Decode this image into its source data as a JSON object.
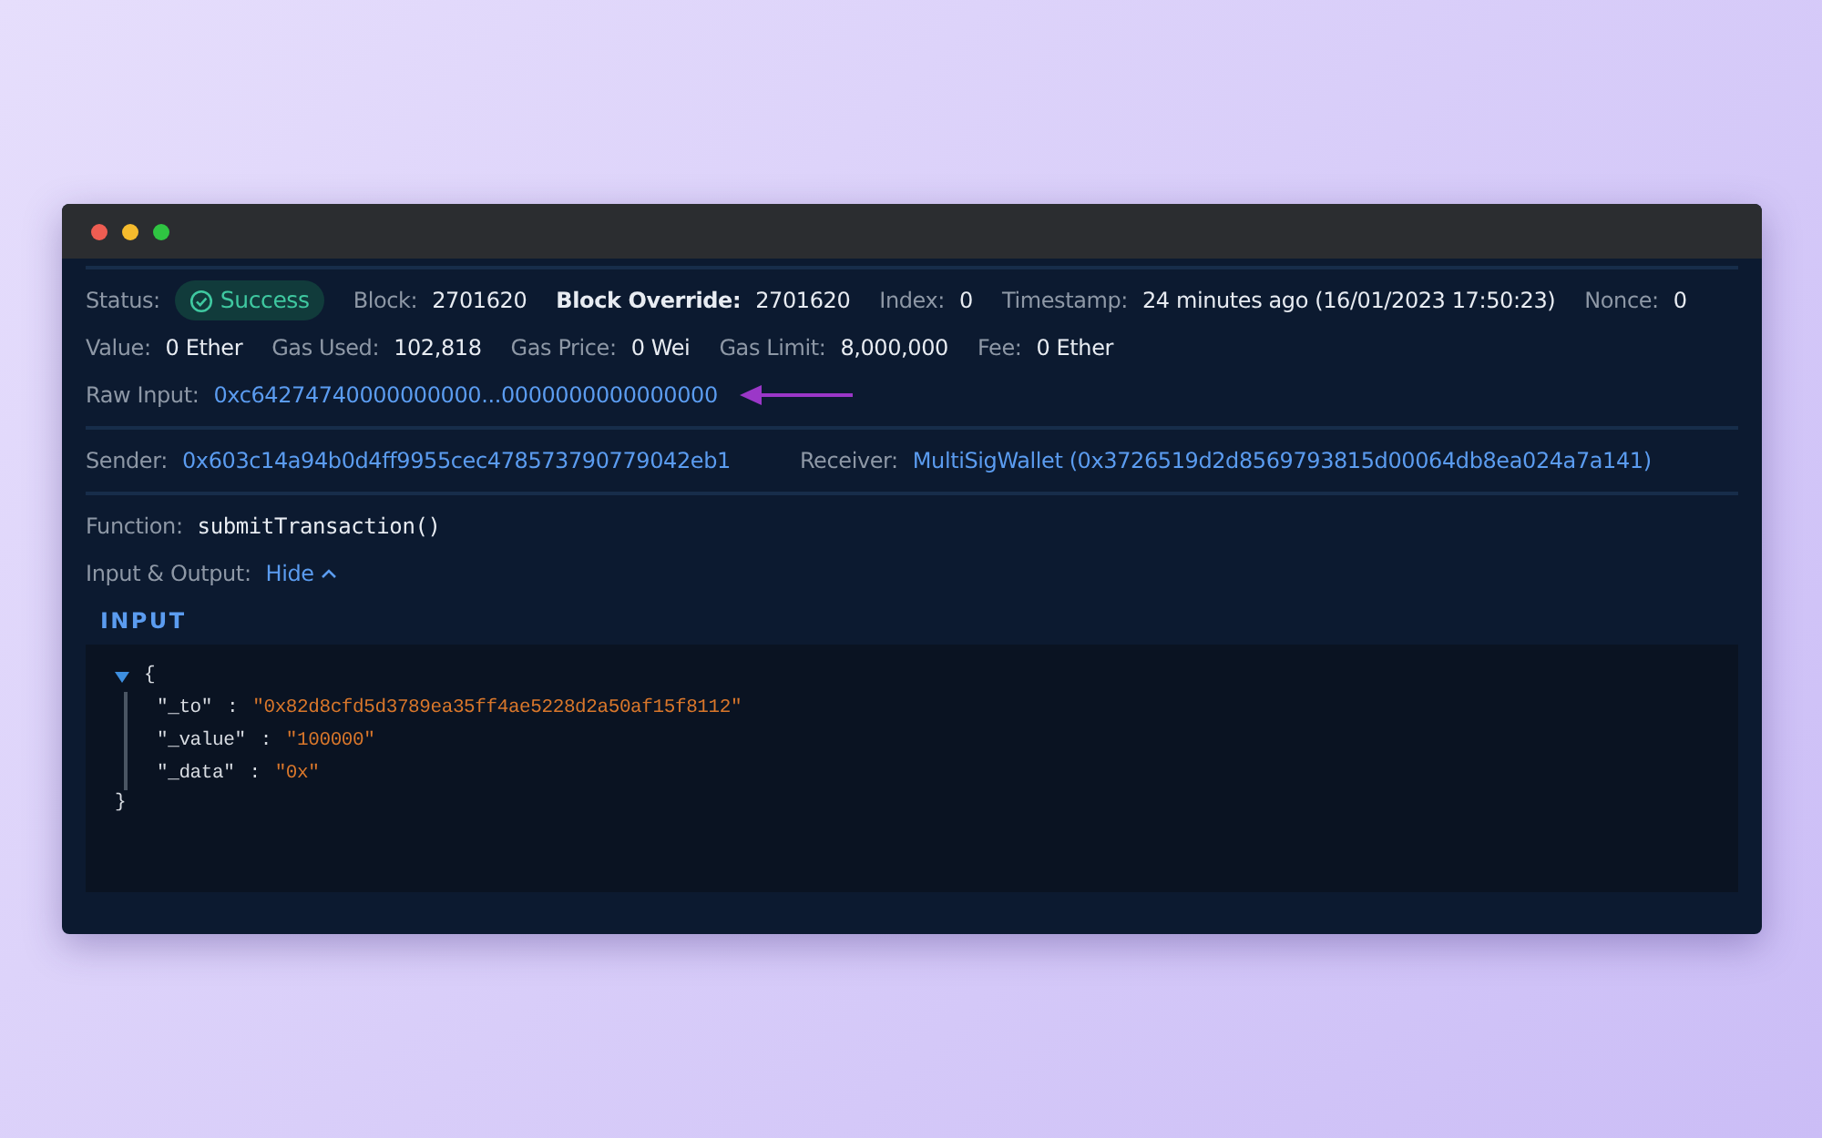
{
  "info_rows": [
    [
      {
        "label": "Status:",
        "value": "Success",
        "kind": "status"
      },
      {
        "label": "Block:",
        "value": "2701620",
        "kind": "plain"
      },
      {
        "label": "Block Override:",
        "value": "2701620",
        "kind": "bold"
      },
      {
        "label": "Index:",
        "value": "0",
        "kind": "plain"
      },
      {
        "label": "Timestamp:",
        "value": "24 minutes ago (16/01/2023 17:50:23)",
        "kind": "plain"
      },
      {
        "label": "Nonce:",
        "value": "0",
        "kind": "plain"
      }
    ],
    [
      {
        "label": "Value:",
        "value": "0 Ether",
        "kind": "plain"
      },
      {
        "label": "Gas Used:",
        "value": "102,818",
        "kind": "plain"
      },
      {
        "label": "Gas Price:",
        "value": "0 Wei",
        "kind": "plain"
      },
      {
        "label": "Gas Limit:",
        "value": "8,000,000",
        "kind": "plain"
      },
      {
        "label": "Fee:",
        "value": "0 Ether",
        "kind": "plain"
      }
    ],
    [
      {
        "label": "Raw Input:",
        "value": "0xc64274740000000000...0000000000000000",
        "kind": "link",
        "pointed": true
      }
    ]
  ],
  "parties": [
    {
      "label": "Sender:",
      "value": "0x603c14a94b0d4ff9955cec478573790779042eb1",
      "kind": "link"
    },
    {
      "label": "Receiver:",
      "value": "MultiSigWallet (0x3726519d2d8569793815d00064db8ea024a7a141)",
      "kind": "link"
    }
  ],
  "function": {
    "label": "Function:",
    "value": "submitTransaction()"
  },
  "io": {
    "label": "Input & Output:",
    "toggle": "Hide",
    "expanded": true
  },
  "input": {
    "heading": "INPUT",
    "open": "{",
    "close": "}",
    "expanded": true,
    "entries": [
      {
        "key": "\"_to\"",
        "colon": ":",
        "value": "\"0x82d8cfd5d3789ea35ff4ae5228d2a50af15f8112\""
      },
      {
        "key": "\"_value\"",
        "colon": ":",
        "value": "\"100000\""
      },
      {
        "key": "\"_data\"",
        "colon": ":",
        "value": "\"0x\""
      }
    ]
  }
}
